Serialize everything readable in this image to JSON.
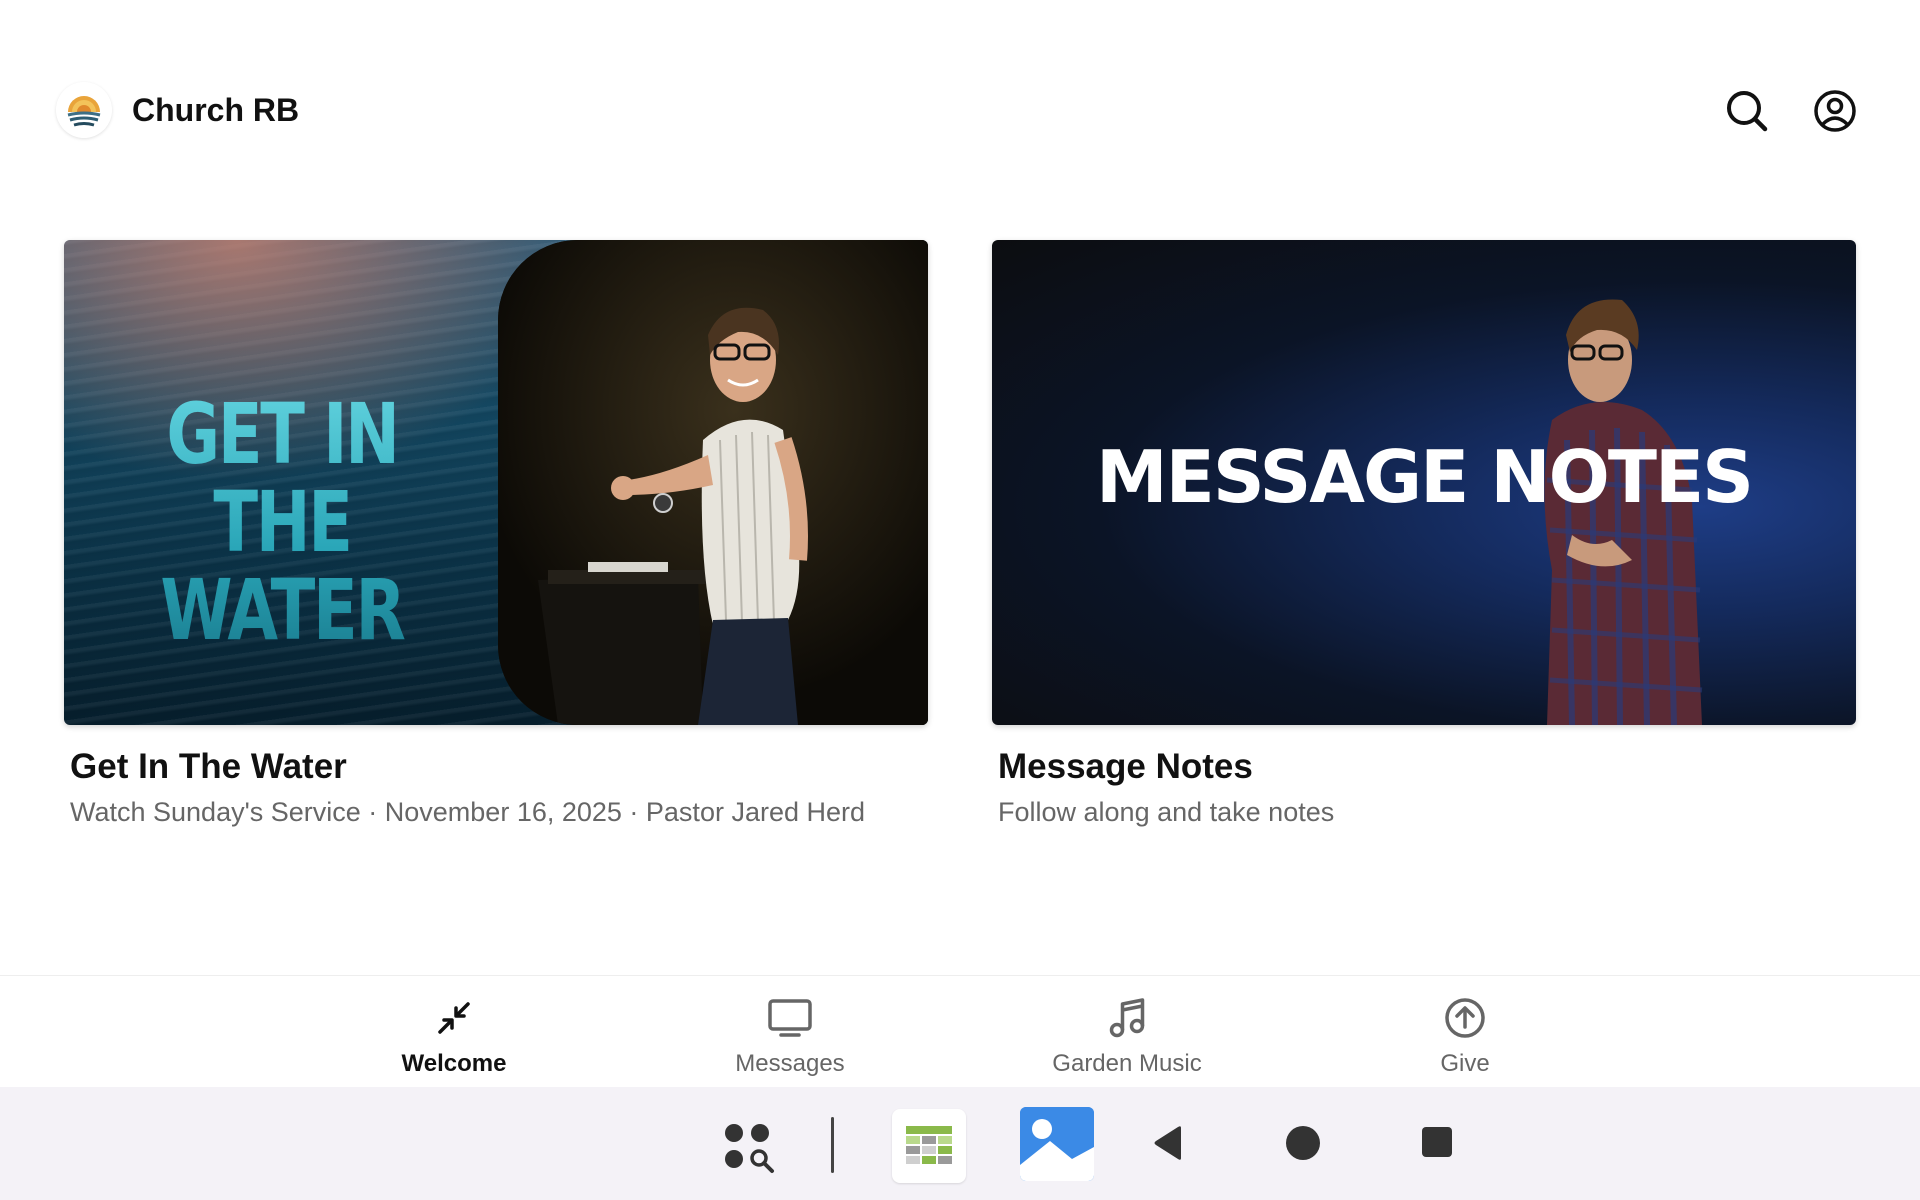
{
  "header": {
    "app_title": "Church RB",
    "logo_icon": "church-sunrise-logo",
    "search_icon": "search-icon",
    "account_icon": "account-circle-icon"
  },
  "cards": [
    {
      "title": "Get In The Water",
      "subtitle": "Watch Sunday's Service · November 16, 2025 · Pastor Jared Herd",
      "thumb_text": "GET IN THE WATER"
    },
    {
      "title": "Message Notes",
      "subtitle": "Follow along and take notes",
      "thumb_text": "MESSAGE NOTES"
    }
  ],
  "tabs": [
    {
      "label": "Welcome",
      "icon": "collapse-arrows-icon",
      "active": true
    },
    {
      "label": "Messages",
      "icon": "monitor-icon",
      "active": false
    },
    {
      "label": "Garden Music",
      "icon": "music-note-icon",
      "active": false
    },
    {
      "label": "Give",
      "icon": "arrow-up-circle-icon",
      "active": false
    }
  ],
  "system_nav": {
    "items": [
      "app-drawer-search-icon",
      "sheets-app-icon",
      "gallery-app-icon",
      "back-icon",
      "home-icon",
      "recents-icon"
    ]
  },
  "colors": {
    "text_primary": "#111111",
    "text_secondary": "#666666",
    "system_bar": "#f4f2f7"
  }
}
